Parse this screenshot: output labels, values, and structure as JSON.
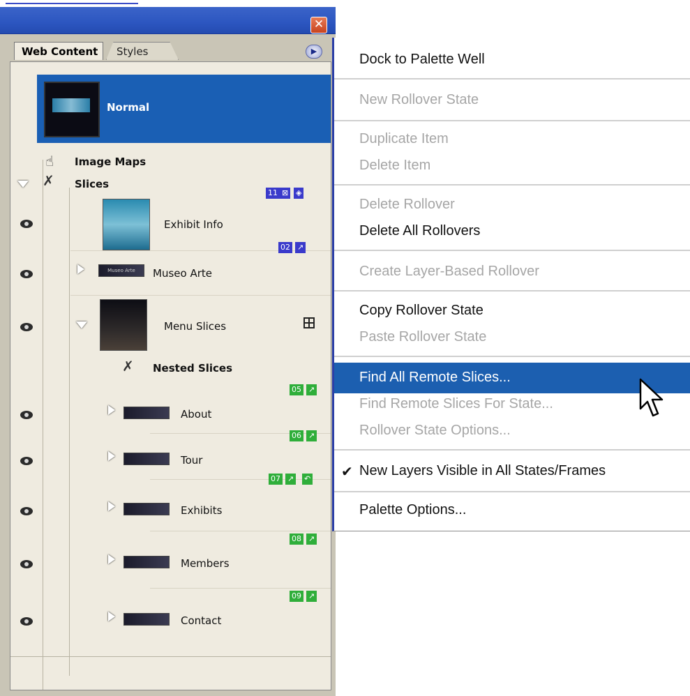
{
  "palette": {
    "tabs": [
      {
        "label": "Web Content"
      },
      {
        "label": "Styles"
      }
    ],
    "states": {
      "normal_label": "Normal"
    },
    "image_maps_label": "Image Maps",
    "slices_label": "Slices",
    "nested_slices_label": "Nested Slices",
    "slices": [
      {
        "label": "Exhibit Info",
        "badge": "11"
      },
      {
        "label": "Museo Arte",
        "badge": "02",
        "thumb_text": "Museo Arte"
      },
      {
        "label": "Menu Slices"
      },
      {
        "label": "About",
        "badge": "05"
      },
      {
        "label": "Tour",
        "badge": "06"
      },
      {
        "label": "Exhibits",
        "badge": "07"
      },
      {
        "label": "Members",
        "badge": "08"
      },
      {
        "label": "Contact",
        "badge": "09"
      }
    ]
  },
  "context_menu": {
    "items": [
      {
        "label": "Dock to Palette Well",
        "enabled": true
      },
      {
        "label": "New Rollover State",
        "enabled": false
      },
      {
        "label": "Duplicate Item",
        "enabled": false
      },
      {
        "label": "Delete Item",
        "enabled": false
      },
      {
        "label": "Delete Rollover",
        "enabled": false
      },
      {
        "label": "Delete All Rollovers",
        "enabled": true
      },
      {
        "label": "Create Layer-Based Rollover",
        "enabled": false
      },
      {
        "label": "Copy Rollover State",
        "enabled": true
      },
      {
        "label": "Paste Rollover State",
        "enabled": false
      },
      {
        "label": "Find All Remote Slices...",
        "enabled": true,
        "highlighted": true
      },
      {
        "label": "Find Remote Slices For State...",
        "enabled": false
      },
      {
        "label": "Rollover State Options...",
        "enabled": false
      },
      {
        "label": "New Layers Visible in All States/Frames",
        "enabled": true,
        "checked": true
      },
      {
        "label": "Palette Options...",
        "enabled": true
      }
    ],
    "check_glyph": "✔"
  },
  "colors": {
    "highlight": "#1c5fb0",
    "title_bar": "#2c56c0",
    "panel_bg": "#efebe0",
    "badge_blue": "#3a3acb",
    "badge_green": "#2fae3a"
  },
  "icons": {
    "close": "close-icon",
    "palette_menu": "palette-menu-arrow-icon",
    "hand": "hand-icon",
    "slice": "slice-tool-icon",
    "eye": "eye-icon",
    "grid": "table-grid-icon",
    "cursor": "mouse-pointer-icon"
  }
}
